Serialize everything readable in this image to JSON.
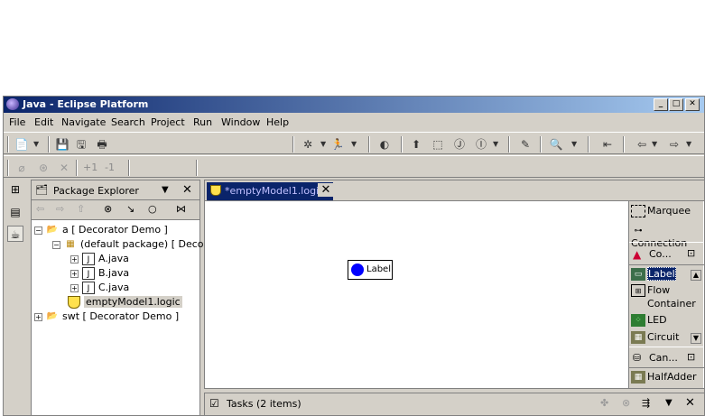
{
  "window": {
    "title": "Java - Eclipse Platform"
  },
  "menu": [
    "File",
    "Edit",
    "Navigate",
    "Search",
    "Project",
    "Run",
    "Window",
    "Help"
  ],
  "toolbar2": {
    "increment": "+1",
    "decrement": "-1"
  },
  "package_explorer": {
    "title": "Package Explorer",
    "tree": [
      {
        "label": "a [ Decorator Demo ]"
      },
      {
        "label": "(default package) [ Decora"
      },
      {
        "label": "A.java"
      },
      {
        "label": "B.java"
      },
      {
        "label": "C.java"
      },
      {
        "label": "emptyModel1.logic"
      },
      {
        "label": "swt [ Decorator Demo ]"
      }
    ]
  },
  "editor": {
    "tab_label": "*emptyModel1.logic",
    "canvas_label": "Label"
  },
  "palette": {
    "items": [
      {
        "label": "Marquee"
      },
      {
        "label": "Connection"
      },
      {
        "label": "Co..."
      },
      {
        "label": "Label"
      },
      {
        "label": "Flow"
      },
      {
        "label": "Container"
      },
      {
        "label": "LED"
      },
      {
        "label": "Circuit"
      },
      {
        "label": "Can..."
      },
      {
        "label": "HalfAdder"
      }
    ]
  },
  "tasks": {
    "title": "Tasks (2 items)"
  },
  "colors": {
    "title_start": "#0a246a",
    "title_end": "#a6caf0",
    "selection": "#0a246a",
    "led_blue": "#0000ff"
  }
}
